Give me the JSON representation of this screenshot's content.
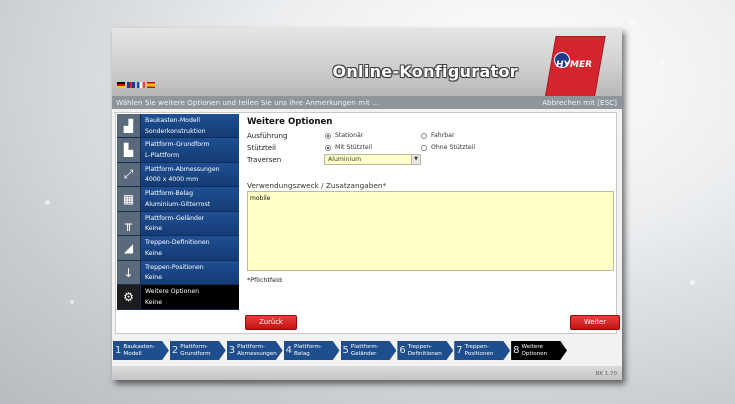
{
  "app": {
    "title": "Online-Konfigurator",
    "brand": "HYMER",
    "languages": [
      "de",
      "en",
      "fr",
      "es"
    ]
  },
  "infobar": {
    "message": "Wählen Sie weitere Optionen und teilen Sie uns ihre Anmerkungen mit ...",
    "abort_label": "Abbrechen mit [ESC]"
  },
  "sidebar": {
    "items": [
      {
        "title": "Baukasten-Modell",
        "value": "Sonderkonstruktion",
        "icon": "stairs-model-icon"
      },
      {
        "title": "Plattform-Grundform",
        "value": "L-Plattform",
        "icon": "l-shape-icon"
      },
      {
        "title": "Plattform-Abmessungen",
        "value": "4000 x 4000 mm",
        "icon": "dimensions-icon"
      },
      {
        "title": "Plattform-Belag",
        "value": "Aluminium-Gitterrost",
        "icon": "grating-icon"
      },
      {
        "title": "Plattform-Geländer",
        "value": "Keine",
        "icon": "railing-icon"
      },
      {
        "title": "Treppen-Definitionen",
        "value": "Keine",
        "icon": "stairs-icon"
      },
      {
        "title": "Treppen-Positionen",
        "value": "Keine",
        "icon": "arrow-down-icon"
      },
      {
        "title": "Weitere Optionen",
        "value": "Keine",
        "icon": "gear-icon"
      }
    ]
  },
  "panel": {
    "title": "Weitere Optionen",
    "ausfuehrung": {
      "label": "Ausführung",
      "options": [
        "Stationär",
        "Fahrbar"
      ],
      "selected": "Stationär"
    },
    "stuetzteil": {
      "label": "Stützteil",
      "options": [
        "Mit Stützteil",
        "Ohne Stützteil"
      ],
      "selected": "Mit Stützteil"
    },
    "traversen": {
      "label": "Traversen",
      "value": "Aluminium"
    },
    "usage": {
      "label": "Verwendungszweck / Zusatzangaben*",
      "value": "mobile"
    },
    "required_note": "*Pflichtfeld"
  },
  "buttons": {
    "back": "Zurück",
    "next": "Weiter"
  },
  "steps": [
    {
      "num": "1",
      "line1": "Baukasten-",
      "line2": "Modell"
    },
    {
      "num": "2",
      "line1": "Plattform-",
      "line2": "Grundform"
    },
    {
      "num": "3",
      "line1": "Plattform-",
      "line2": "Abmessungen"
    },
    {
      "num": "4",
      "line1": "Plattform-",
      "line2": "Belag"
    },
    {
      "num": "5",
      "line1": "Plattform-",
      "line2": "Geländer"
    },
    {
      "num": "6",
      "line1": "Treppen-",
      "line2": "Definitionen"
    },
    {
      "num": "7",
      "line1": "Treppen-",
      "line2": "Positionen"
    },
    {
      "num": "8",
      "line1": "Weitere",
      "line2": "Optionen"
    }
  ],
  "version": "BK 1.70",
  "colors": {
    "accent_red": "#d4252e",
    "nav_blue": "#1f4e8f",
    "input_yellow": "#ffffc8"
  }
}
